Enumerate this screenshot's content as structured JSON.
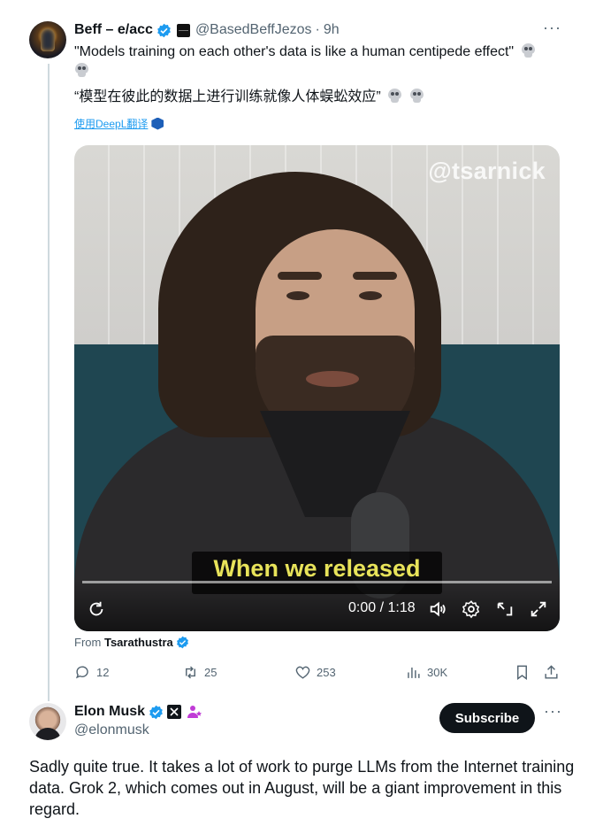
{
  "tweet1": {
    "display_name": "Beff – e/acc",
    "handle": "@BasedBeffJezos",
    "separator": "·",
    "time": "9h",
    "more": "···",
    "text_en": "\"Models training on each other's data is like a human centipede effect\"",
    "text_zh": "“模型在彼此的数据上进行训练就像人体蜈蚣效应”",
    "translate_label": "使用DeepL翻译",
    "video": {
      "watermark": "@tsarnick",
      "subtitle": "When we released",
      "time": "0:00 / 1:18",
      "progress": 0
    },
    "from_label": "From",
    "from_name": "Tsarathustra",
    "stats": {
      "replies": "12",
      "reposts": "25",
      "likes": "253",
      "views": "30K"
    }
  },
  "tweet2": {
    "display_name": "Elon Musk",
    "handle": "@elonmusk",
    "subscribe_label": "Subscribe",
    "more": "···",
    "text": "Sadly quite true. It takes a lot of work to purge LLMs from the Internet training data. Grok 2, which comes out in August, will be a giant improvement in this regard."
  },
  "colors": {
    "accent": "#1d9bf0",
    "muted": "#536471",
    "text": "#0f1419",
    "subtitle": "#e8e35a"
  }
}
